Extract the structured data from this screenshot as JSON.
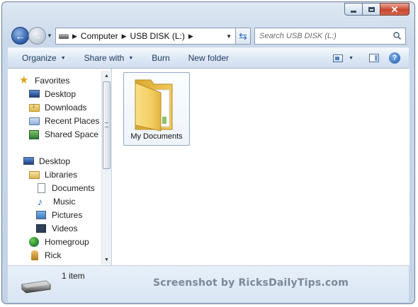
{
  "window": {
    "caption_buttons": [
      "minimize-icon",
      "maximize-icon",
      "close-icon"
    ]
  },
  "address_bar": {
    "crumbs": [
      "Computer",
      "USB DISK (L:)"
    ]
  },
  "search": {
    "placeholder": "Search USB DISK (L:)"
  },
  "toolbar": {
    "organize": "Organize",
    "share_with": "Share with",
    "burn": "Burn",
    "new_folder": "New folder",
    "help": "?"
  },
  "sidebar": {
    "favorites": {
      "label": "Favorites",
      "items": [
        "Desktop",
        "Downloads",
        "Recent Places",
        "Shared Space"
      ]
    },
    "desktop": "Desktop",
    "libraries": {
      "label": "Libraries",
      "items": [
        "Documents",
        "Music",
        "Pictures",
        "Videos"
      ]
    },
    "homegroup": "Homegroup",
    "user": "Rick"
  },
  "content": {
    "items": [
      {
        "name": "My Documents",
        "type": "folder"
      }
    ]
  },
  "status_bar": {
    "item_count": "1 item",
    "watermark": "Screenshot by RicksDailyTips.com"
  },
  "colors": {
    "window_frame": "#c9d8ea",
    "toolbar": "#dde8f5",
    "close_button": "#c9472f",
    "selection_border": "#94a8c4"
  }
}
